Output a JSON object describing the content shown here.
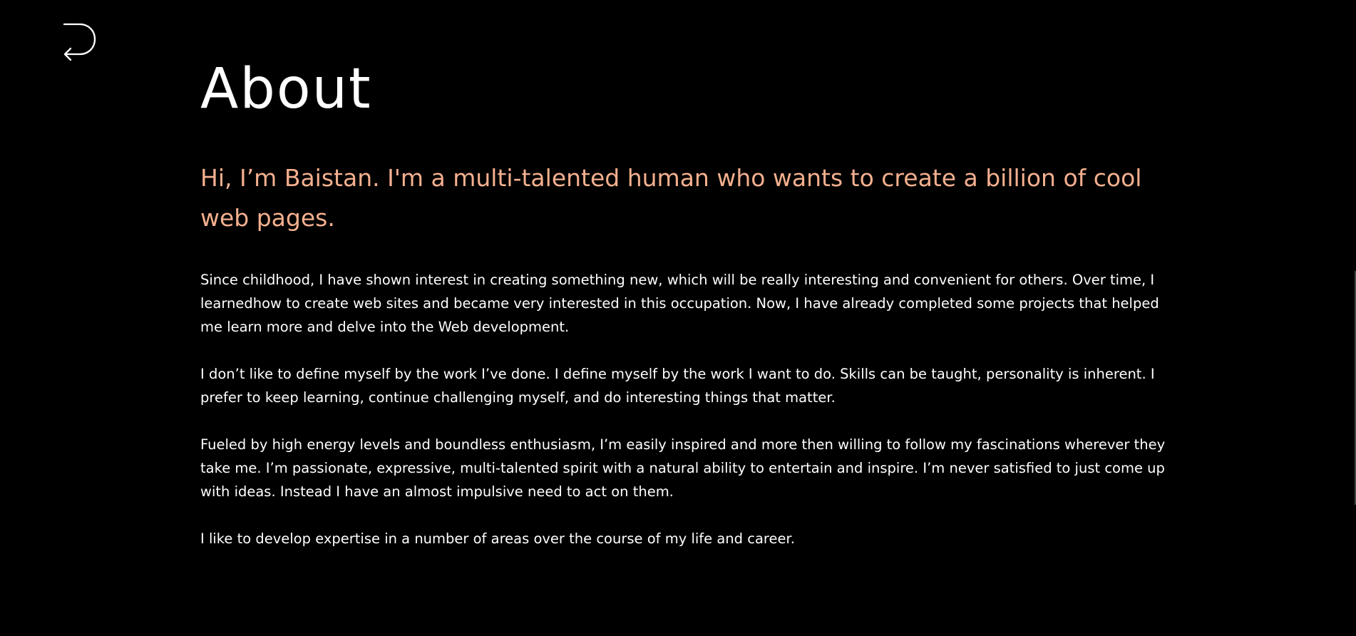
{
  "nav": {
    "back_icon": "back-arrow-icon"
  },
  "page": {
    "title": "About",
    "intro": "Hi, I’m Baistan. I'm a multi-talented human who wants to create a billion of cool web pages.",
    "paragraphs": [
      "Since childhood, I have shown interest in creating something new, which will be really interesting and convenient for others. Over time, I learnedhow to create web sites and became very interested in this occupation. Now, I have already completed some projects that helped me learn more and delve into the Web development.",
      "I don’t like to define myself by the work I’ve done. I define myself by the work I want to do. Skills can be taught, personality is inherent. I prefer to keep learning, continue challenging myself, and do interesting things that matter.",
      "Fueled by high energy levels and boundless enthusiasm, I’m easily inspired and more then willing to follow my fascinations wherever they take me. I’m passionate, expressive, multi-talented spirit with a natural ability to entertain and inspire. I’m never satisfied to just come up with ideas. Instead I have an almost impulsive need to act on them.",
      "I like to develop expertise in a number of areas over the course of my life and career."
    ]
  },
  "colors": {
    "background": "#000000",
    "text": "#ffffff",
    "accent": "#f4b08f"
  }
}
